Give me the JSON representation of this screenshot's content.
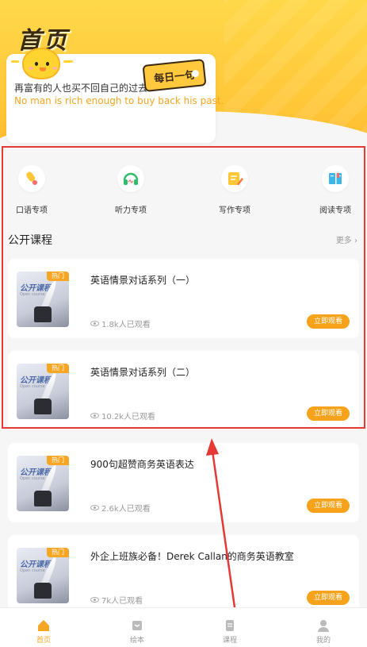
{
  "header": {
    "title": "首页"
  },
  "quote": {
    "badge": "每日一句",
    "cn": "再富有的人也买不回自己的过去.",
    "en": "No man is rich enough to buy back his past."
  },
  "categories": [
    {
      "label": "口语专项",
      "icon": "speaking-icon"
    },
    {
      "label": "听力专项",
      "icon": "headphones-icon"
    },
    {
      "label": "写作专项",
      "icon": "writing-icon"
    },
    {
      "label": "阅读专项",
      "icon": "book-icon"
    }
  ],
  "section": {
    "title": "公开课程",
    "more": "更多 ›"
  },
  "courses": [
    {
      "title": "英语情景对话系列（一）",
      "views": "1.8k人已观看",
      "badge": "热门",
      "button": "立即观看",
      "thumb_title": "公开课程",
      "thumb_sub": "Open course"
    },
    {
      "title": "英语情景对话系列（二）",
      "views": "10.2k人已观看",
      "badge": "热门",
      "button": "立即观看",
      "thumb_title": "公开课程",
      "thumb_sub": "Open course"
    },
    {
      "title": "900句超赞商务英语表达",
      "views": "2.6k人已观看",
      "badge": "热门",
      "button": "立即观看",
      "thumb_title": "公开课程",
      "thumb_sub": "Open course"
    },
    {
      "title": "外企上班族必备！Derek Callan的商务英语教室",
      "views": "7k人已观看",
      "badge": "热门",
      "button": "立即观看",
      "thumb_title": "公开课程",
      "thumb_sub": "Open course"
    }
  ],
  "tabs": [
    {
      "label": "首页",
      "icon": "home-icon",
      "active": true
    },
    {
      "label": "绘本",
      "icon": "picture-book-icon",
      "active": false
    },
    {
      "label": "课程",
      "icon": "course-icon",
      "active": false
    },
    {
      "label": "我的",
      "icon": "profile-icon",
      "active": false
    }
  ],
  "colors": {
    "accent": "#f5a623",
    "highlight": "#e53935",
    "header": "#ffc637"
  }
}
